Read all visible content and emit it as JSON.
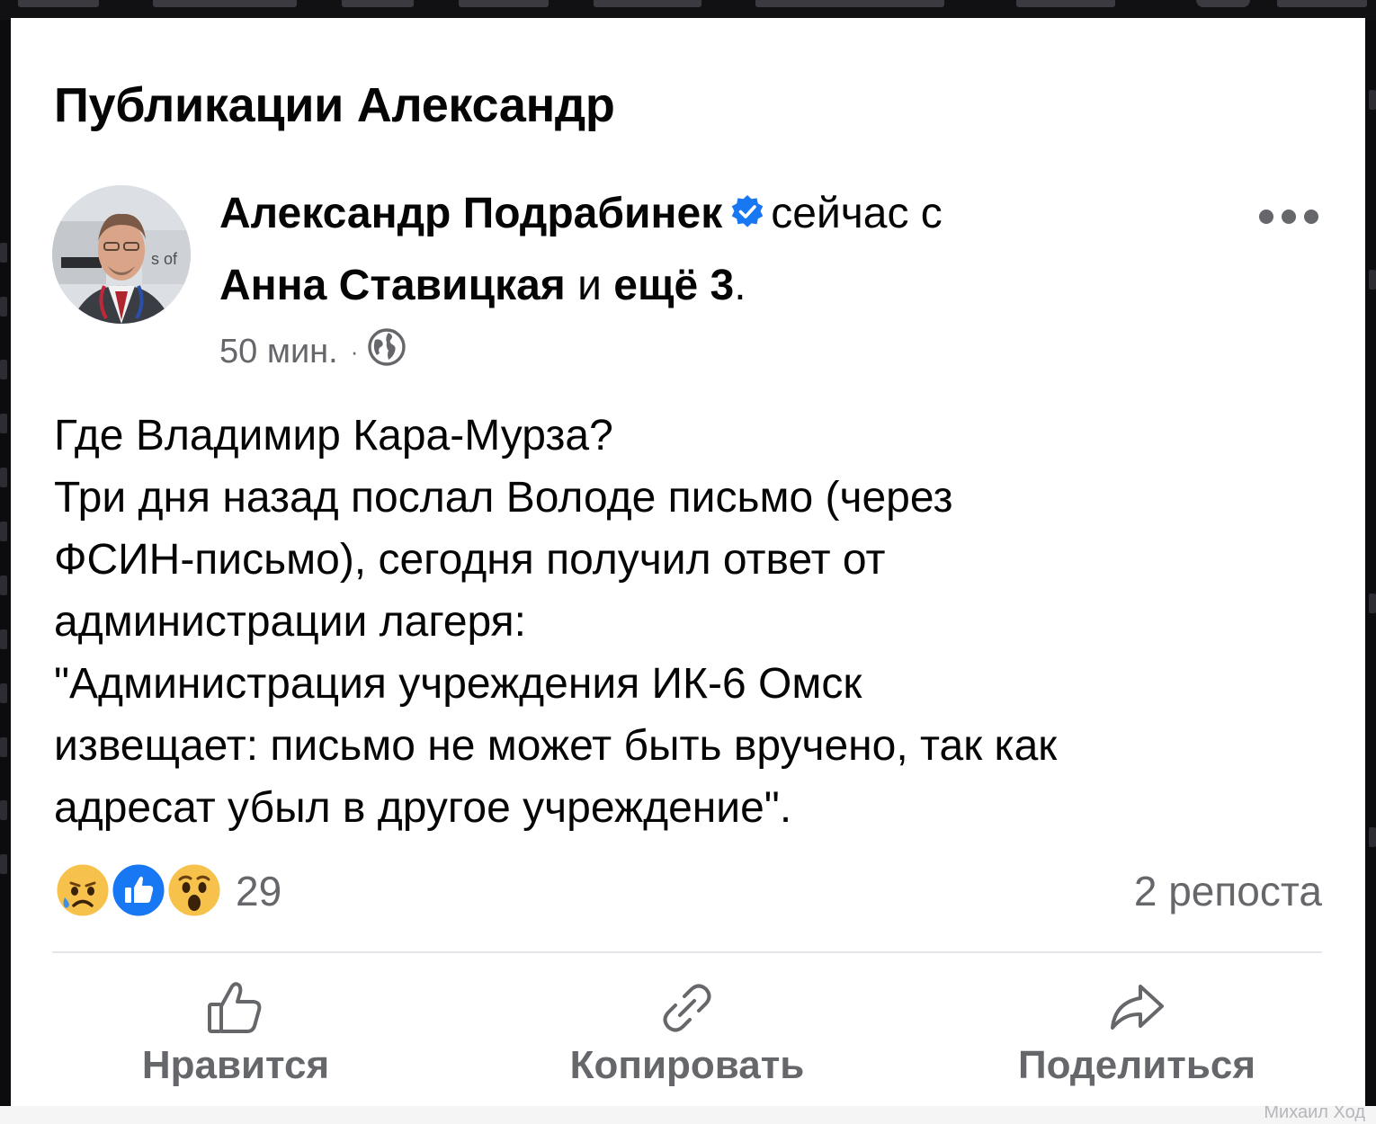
{
  "page": {
    "title": "Публикации Александр"
  },
  "post": {
    "author": "Александр Подрабинек",
    "verified_icon": "verified-badge-icon",
    "with_text": "сейчас с",
    "tagged_person": "Анна Ставицкая",
    "and_text": "и",
    "others": "ещё 3",
    "period": ".",
    "time": "50 мин.",
    "separator": "·",
    "privacy_icon": "globe-icon",
    "body_lines": [
      "Где Владимир Кара-Мурза?",
      "Три дня назад послал Володе письмо (через",
      "ФСИН-письмо), сегодня получил ответ от",
      "администрации лагеря:",
      "\"Администрация учреждения ИК-6 Омск",
      "извещает: письмо не может быть вручено, так как",
      "адресат убыл в другое учреждение\"."
    ],
    "reactions": {
      "icons": [
        "sad-reaction-icon",
        "like-reaction-icon",
        "wow-reaction-icon"
      ],
      "count": "29"
    },
    "shares": "2 репоста"
  },
  "actions": {
    "like": "Нравится",
    "copy": "Копировать",
    "share": "Поделиться"
  },
  "background": {
    "bottom_right_name": "Михаил Ход"
  },
  "colors": {
    "text_primary": "#050505",
    "text_secondary": "#65676b",
    "verified_blue": "#1877f2",
    "divider": "#e4e6eb"
  }
}
